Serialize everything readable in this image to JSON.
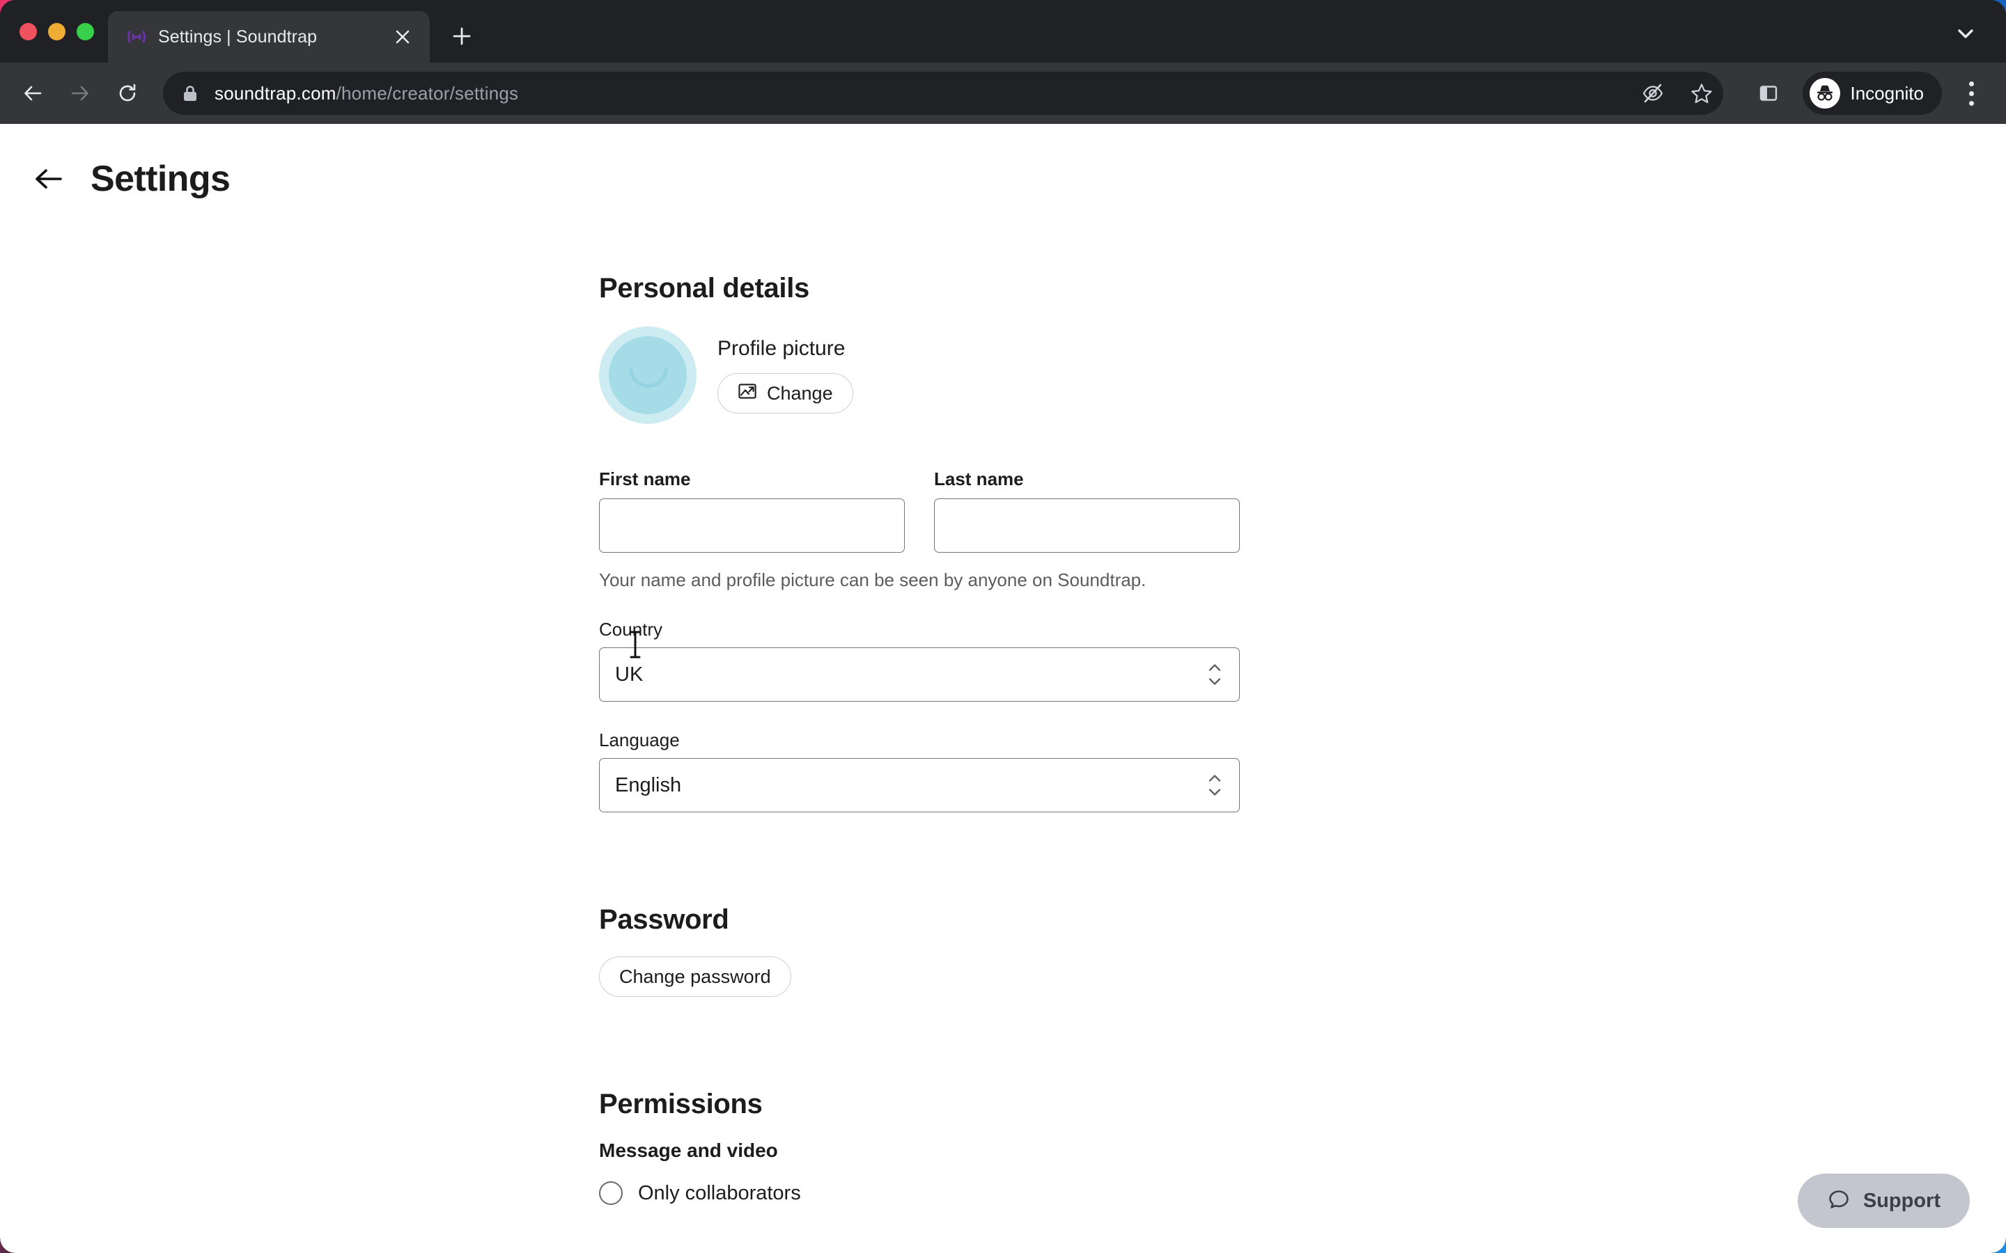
{
  "browser": {
    "tab": {
      "title": "Settings | Soundtrap",
      "favicon_name": "soundtrap-logo-icon",
      "close_label": "×"
    },
    "new_tab_label": "+",
    "tabstrip_chevron_name": "chevron-down-icon",
    "toolbar": {
      "back_label": "←",
      "forward_label": "→",
      "reload_label": "↻",
      "url_host": "soundtrap.com",
      "url_path": "/home/creator/settings",
      "lock_name": "lock-icon",
      "tracking_protection_name": "eye-off-icon",
      "bookmark_name": "star-icon",
      "side_panel_name": "side-panel-icon",
      "profile_label": "Incognito",
      "profile_avatar_name": "incognito-icon",
      "menu_name": "three-dot-menu-icon"
    }
  },
  "page": {
    "back_name": "back-arrow-icon",
    "title": "Settings",
    "personal_details": {
      "heading": "Personal details",
      "profile_picture_label": "Profile picture",
      "change_button": "Change",
      "change_icon_name": "image-icon",
      "first_name": {
        "label": "First name",
        "value": "",
        "placeholder": ""
      },
      "last_name": {
        "label": "Last name",
        "value": "",
        "placeholder": ""
      },
      "helper_text": "Your name and profile picture can be seen by anyone on Soundtrap.",
      "country": {
        "label": "Country",
        "value": "UK"
      },
      "language": {
        "label": "Language",
        "value": "English"
      }
    },
    "password": {
      "heading": "Password",
      "change_password_button": "Change password"
    },
    "permissions": {
      "heading": "Permissions",
      "subheading": "Message and video",
      "options": [
        {
          "label": "Only collaborators",
          "selected": false
        }
      ]
    },
    "support": {
      "label": "Support",
      "icon_name": "chat-bubble-icon"
    }
  },
  "colors": {
    "chrome_bg": "#202124",
    "toolbar_bg": "#35363a",
    "page_bg": "#ffffff",
    "text_primary": "#1c1c1c",
    "text_muted": "#5c5c5c",
    "avatar_ring": "#cdecf1",
    "avatar_face": "#a5dce8",
    "support_bg": "#c3c6ce",
    "favicon_purple": "#5a2d91"
  }
}
